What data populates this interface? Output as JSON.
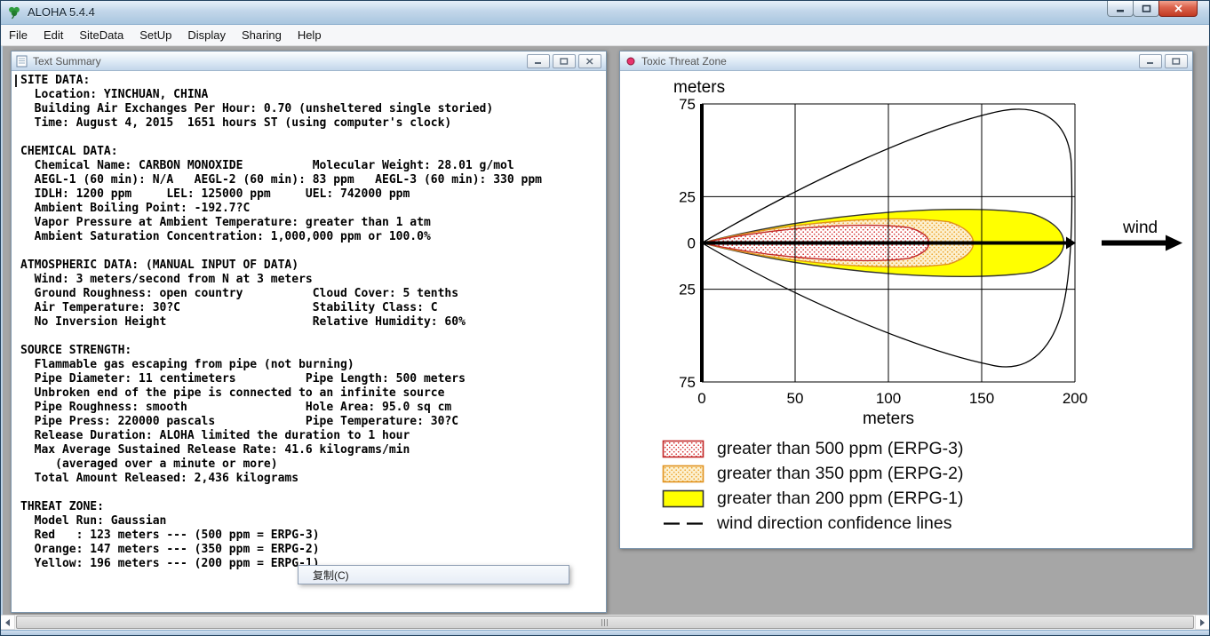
{
  "app": {
    "title": "ALOHA 5.4.4",
    "menu_items": [
      "File",
      "Edit",
      "SiteData",
      "SetUp",
      "Display",
      "Sharing",
      "Help"
    ]
  },
  "text_summary_window": {
    "title": "Text Summary",
    "lines": [
      "SITE DATA:",
      "  Location: YINCHUAN, CHINA",
      "  Building Air Exchanges Per Hour: 0.70 (unsheltered single storied)",
      "  Time: August 4, 2015  1651 hours ST (using computer's clock)",
      "",
      "CHEMICAL DATA:",
      "  Chemical Name: CARBON MONOXIDE          Molecular Weight: 28.01 g/mol",
      "  AEGL-1 (60 min): N/A   AEGL-2 (60 min): 83 ppm   AEGL-3 (60 min): 330 ppm",
      "  IDLH: 1200 ppm     LEL: 125000 ppm     UEL: 742000 ppm",
      "  Ambient Boiling Point: -192.7?C",
      "  Vapor Pressure at Ambient Temperature: greater than 1 atm",
      "  Ambient Saturation Concentration: 1,000,000 ppm or 100.0%",
      "",
      "ATMOSPHERIC DATA: (MANUAL INPUT OF DATA)",
      "  Wind: 3 meters/second from N at 3 meters",
      "  Ground Roughness: open country          Cloud Cover: 5 tenths",
      "  Air Temperature: 30?C                   Stability Class: C",
      "  No Inversion Height                     Relative Humidity: 60%",
      "",
      "SOURCE STRENGTH:",
      "  Flammable gas escaping from pipe (not burning)",
      "  Pipe Diameter: 11 centimeters          Pipe Length: 500 meters",
      "  Unbroken end of the pipe is connected to an infinite source",
      "  Pipe Roughness: smooth                 Hole Area: 95.0 sq cm",
      "  Pipe Press: 220000 pascals             Pipe Temperature: 30?C",
      "  Release Duration: ALOHA limited the duration to 1 hour",
      "  Max Average Sustained Release Rate: 41.6 kilograms/min",
      "     (averaged over a minute or more)",
      "  Total Amount Released: 2,436 kilograms",
      "",
      "THREAT ZONE:",
      "  Model Run: Gaussian",
      "  Red   : 123 meters --- (500 ppm = ERPG-3)",
      "  Orange: 147 meters --- (350 ppm = ERPG-2)",
      "  Yellow: 196 meters --- (200 ppm = ERPG-1)"
    ]
  },
  "threat_zone_window": {
    "title": "Toxic Threat Zone",
    "wind_label": "wind",
    "chart_data": {
      "type": "area",
      "title": "",
      "xlabel": "meters",
      "ylabel": "meters",
      "xlim": [
        0,
        200
      ],
      "ylim": [
        -75,
        75
      ],
      "x_ticks": [
        0,
        50,
        100,
        150,
        200
      ],
      "y_tick_values": [
        75,
        25,
        0,
        -25,
        -75
      ],
      "y_tick_labels": [
        "75",
        "25",
        "0",
        "25",
        "75"
      ],
      "grid": true,
      "zones": [
        {
          "name": "red",
          "threshold_ppm": 500,
          "guideline": "ERPG-3",
          "length_m": 123,
          "half_width_m": 11,
          "style": "red-dots"
        },
        {
          "name": "orange",
          "threshold_ppm": 350,
          "guideline": "ERPG-2",
          "length_m": 147,
          "half_width_m": 15,
          "style": "orange-dots"
        },
        {
          "name": "yellow",
          "threshold_ppm": 200,
          "guideline": "ERPG-1",
          "length_m": 196,
          "half_width_m": 21,
          "style": "yellow-solid"
        }
      ],
      "confidence": {
        "length_m": 198,
        "half_width_m": 73
      }
    },
    "legend": [
      {
        "style": "red-dots",
        "label": "greater than 500 ppm (ERPG-3)"
      },
      {
        "style": "orange-dots",
        "label": "greater than 350 ppm (ERPG-2)"
      },
      {
        "style": "yellow-solid",
        "label": "greater than 200 ppm (ERPG-1)"
      },
      {
        "style": "dashed-line",
        "label": "wind direction confidence lines"
      }
    ]
  },
  "context_menu": {
    "items": [
      {
        "label": "复制(C)"
      }
    ]
  },
  "colors": {
    "red_dots": "#d42b2b",
    "red_stroke": "#c22727",
    "orange_dots": "#eda126",
    "orange_fill": "#fcf0cf",
    "orange_stroke": "#e0921e",
    "yellow_fill": "#ffff00",
    "yellow_stroke": "#333333",
    "confidence_stroke": "#000000"
  }
}
